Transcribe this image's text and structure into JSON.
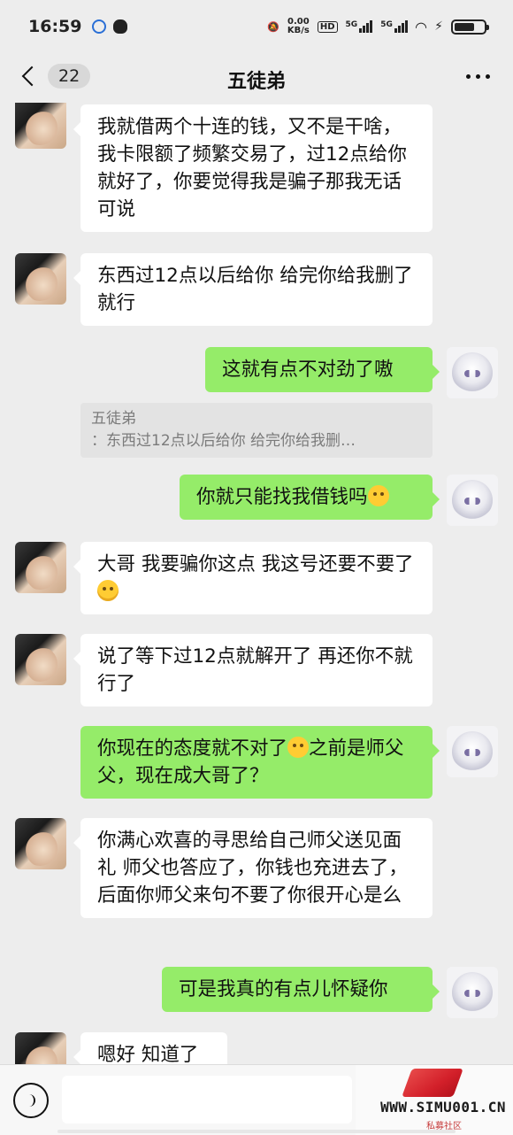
{
  "status_bar": {
    "time": "16:59",
    "net_speed_value": "0.00",
    "net_speed_unit": "KB/s",
    "hd_label": "HD",
    "sim1_label": "5G",
    "sim2_label": "5G",
    "battery_level": 0.7
  },
  "header": {
    "unread_count": "22",
    "title": "五徒弟"
  },
  "messages": [
    {
      "side": "left",
      "text": "我就借两个十连的钱，又不是干啥，我卡限额了频繁交易了，过12点给你就好了，你要觉得我是骗子那我无话可说"
    },
    {
      "side": "left",
      "text": "东西过12点以后给你  给完你给我删了就行"
    },
    {
      "side": "right",
      "text": "这就有点不对劲了嗷"
    },
    {
      "quote_name": "五徒弟",
      "quote_text": "：东西过12点以后给你  给完你给我删…"
    },
    {
      "side": "right",
      "text": "你就只能找我借钱吗",
      "emoji": "crying-face"
    },
    {
      "side": "left",
      "text": "大哥 我要骗你这点 我这号还要不要了",
      "emoji": "sweat-face"
    },
    {
      "side": "left",
      "text": "说了等下过12点就解开了 再还你不就行了"
    },
    {
      "side": "right",
      "text_before": "你现在的态度就不对了",
      "emoji": "sob-face",
      "text_after": "之前是师父父，现在成大哥了？"
    },
    {
      "side": "left",
      "text": "你满心欢喜的寻思给自己师父送见面礼 师父也答应了，你钱也充进去了，后面你师父来句不要了你很开心是么"
    },
    {
      "side": "right",
      "text": "可是我真的有点儿怀疑你"
    },
    {
      "side": "left",
      "text": "嗯好 知道了"
    }
  ],
  "input_bar": {
    "placeholder": "",
    "voice_icon": "voice-icon"
  },
  "watermark": {
    "text": "WWW.SIMU001.CN",
    "subtext": "私募社区"
  },
  "colors": {
    "background": "#ededed",
    "bubble_sent": "#95ec69",
    "bubble_received": "#ffffff"
  }
}
